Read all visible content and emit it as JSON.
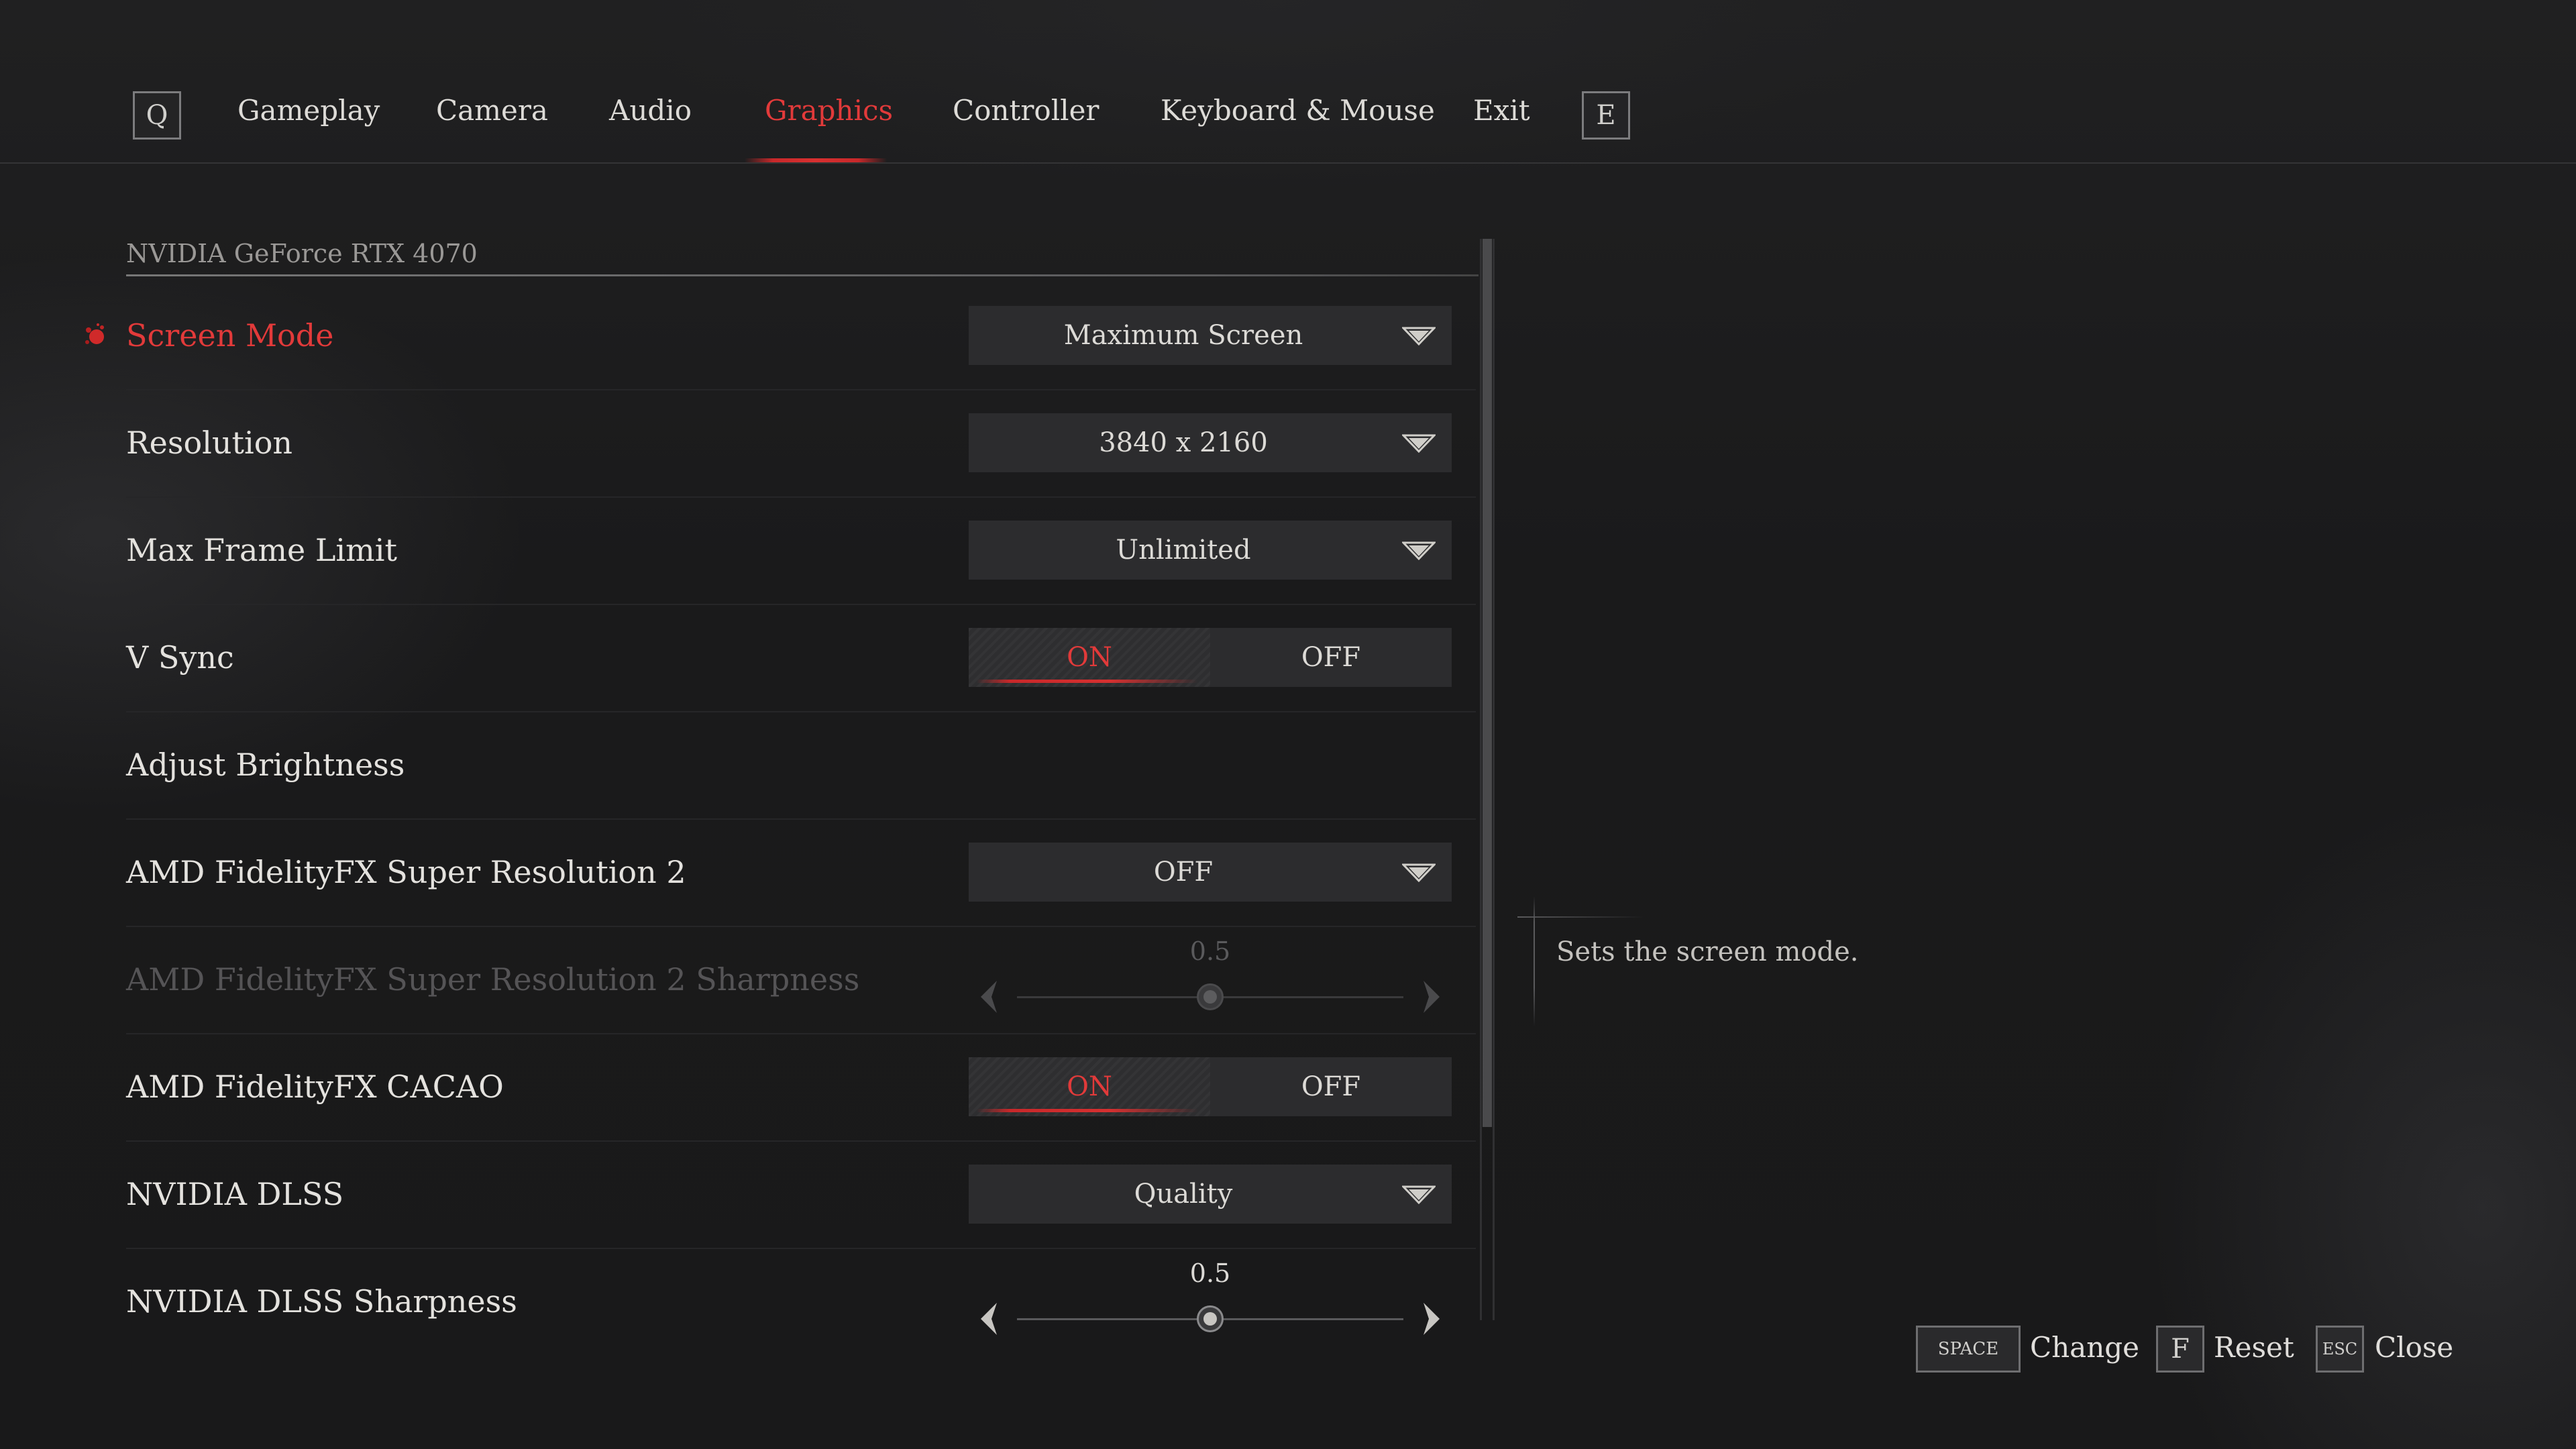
{
  "nav": {
    "prev_key": "Q",
    "next_key": "E",
    "tabs": [
      {
        "label": "Gameplay"
      },
      {
        "label": "Camera"
      },
      {
        "label": "Audio"
      },
      {
        "label": "Graphics"
      },
      {
        "label": "Controller"
      },
      {
        "label": "Keyboard & Mouse"
      },
      {
        "label": "Exit"
      }
    ],
    "active_tab": "Graphics"
  },
  "gpu_name": "NVIDIA GeForce RTX 4070",
  "settings": [
    {
      "label": "Screen Mode",
      "control": "dropdown",
      "value": "Maximum Screen",
      "selected": true
    },
    {
      "label": "Resolution",
      "control": "dropdown",
      "value": "3840 x 2160"
    },
    {
      "label": "Max Frame Limit",
      "control": "dropdown",
      "value": "Unlimited"
    },
    {
      "label": "V Sync",
      "control": "toggle",
      "on_label": "ON",
      "off_label": "OFF",
      "value": "ON"
    },
    {
      "label": "Adjust Brightness",
      "control": "none"
    },
    {
      "label": "AMD FidelityFX Super Resolution 2",
      "control": "dropdown",
      "value": "OFF"
    },
    {
      "label": "AMD FidelityFX Super Resolution 2 Sharpness",
      "control": "slider",
      "value": "0.5",
      "fraction": 0.5,
      "disabled": true
    },
    {
      "label": "AMD FidelityFX CACAO",
      "control": "toggle",
      "on_label": "ON",
      "off_label": "OFF",
      "value": "ON"
    },
    {
      "label": "NVIDIA DLSS",
      "control": "dropdown",
      "value": "Quality"
    },
    {
      "label": "NVIDIA DLSS Sharpness",
      "control": "slider",
      "value": "0.5",
      "fraction": 0.5
    }
  ],
  "description": "Sets the screen mode.",
  "hints": [
    {
      "key": "SPACE",
      "label": "Change"
    },
    {
      "key": "F",
      "label": "Reset"
    },
    {
      "key": "ESC",
      "label": "Close"
    }
  ],
  "colors": {
    "accent": "#e23a3a",
    "background": "#1a1a1b",
    "control_bg": "#2c2c2e",
    "text": "#e4e2de",
    "disabled_text": "#555456"
  }
}
